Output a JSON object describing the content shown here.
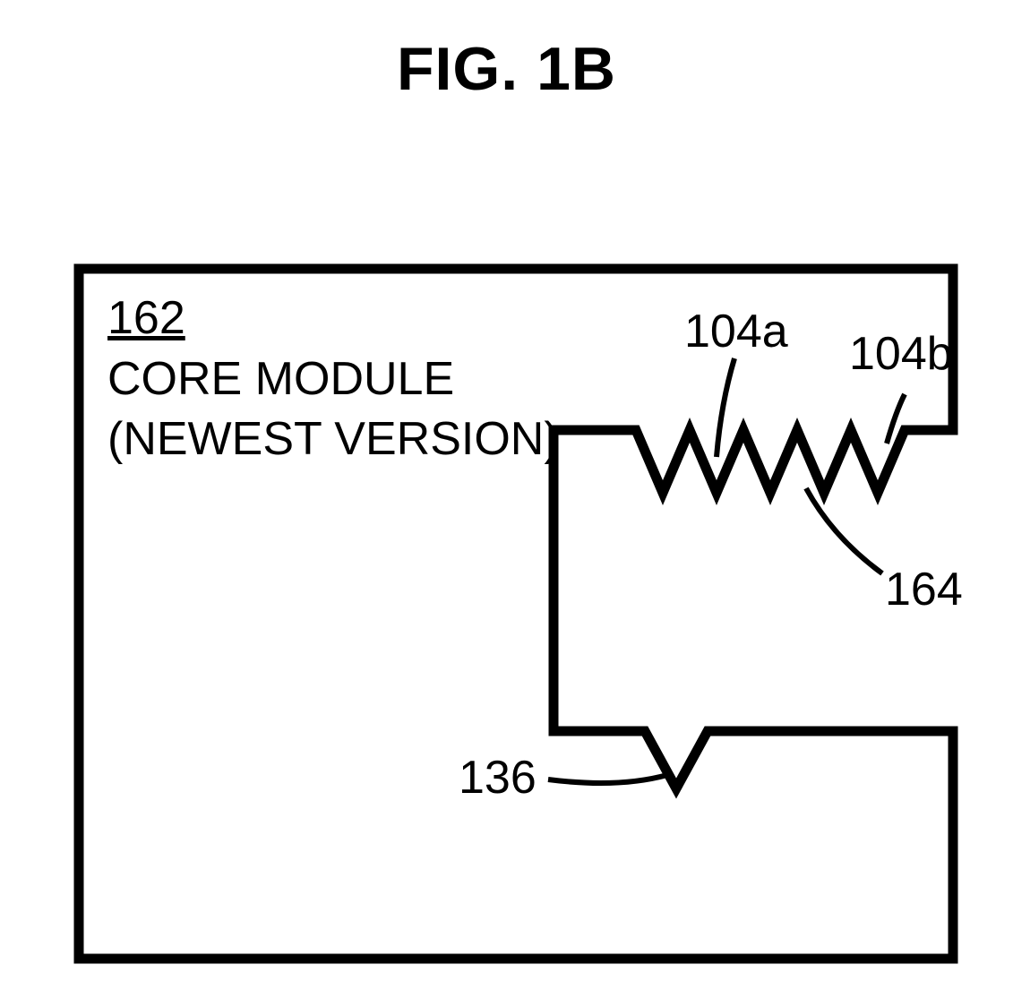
{
  "figure": {
    "title": "FIG. 1B",
    "labels": {
      "module_id": "162",
      "module_name_line1": "CORE  MODULE",
      "module_name_line2": "(NEWEST VERSION)",
      "ref_104a": "104a",
      "ref_104b": "104b",
      "ref_164": "164",
      "ref_136": "136"
    }
  }
}
